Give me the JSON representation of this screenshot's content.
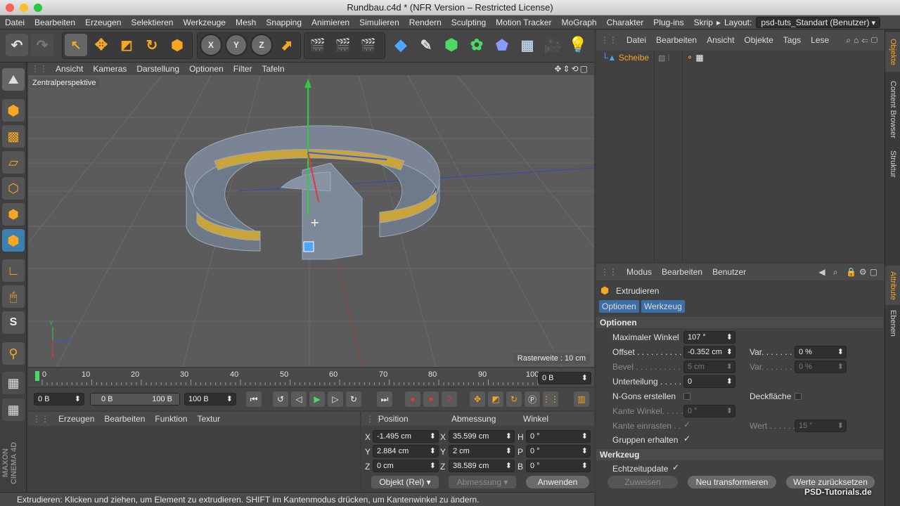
{
  "window": {
    "title": "Rundbau.c4d * (NFR Version – Restricted License)"
  },
  "menu": {
    "items": [
      "Datei",
      "Bearbeiten",
      "Erzeugen",
      "Selektieren",
      "Werkzeuge",
      "Mesh",
      "Snapping",
      "Animieren",
      "Simulieren",
      "Rendern",
      "Sculpting",
      "Motion Tracker",
      "MoGraph",
      "Charakter",
      "Plug-ins",
      "Skrip"
    ],
    "layout_label": "Layout:",
    "layout_value": "psd-tuts_Standart (Benutzer)"
  },
  "toolbar": {
    "axis_x": "X",
    "axis_y": "Y",
    "axis_z": "Z"
  },
  "viewport": {
    "menu": [
      "Ansicht",
      "Kameras",
      "Darstellung",
      "Optionen",
      "Filter",
      "Tafeln"
    ],
    "camera_label": "Zentralperspektive",
    "grid_label": "Rasterweite : 10 cm"
  },
  "timeline": {
    "ticks": [
      "0",
      "10",
      "20",
      "30",
      "40",
      "50",
      "60",
      "70",
      "80",
      "90",
      "100"
    ],
    "current": "0 B"
  },
  "transport": {
    "start": "0 B",
    "range_start": "0 B",
    "range_end": "100 B",
    "end": "100 B"
  },
  "material": {
    "menu": [
      "Erzeugen",
      "Bearbeiten",
      "Funktion",
      "Textur"
    ]
  },
  "coords": {
    "headers": {
      "position": "Position",
      "size": "Abmessung",
      "rotation": "Winkel"
    },
    "rows": [
      {
        "axis": "X",
        "pos": "-1.495 cm",
        "size_axis": "X",
        "size": "35.599 cm",
        "rot_axis": "H",
        "rot": "0 °"
      },
      {
        "axis": "Y",
        "pos": "2.884 cm",
        "size_axis": "Y",
        "size": "2 cm",
        "rot_axis": "P",
        "rot": "0 °"
      },
      {
        "axis": "Z",
        "pos": "0 cm",
        "size_axis": "Z",
        "size": "38.589 cm",
        "rot_axis": "B",
        "rot": "0 °"
      }
    ],
    "mode": "Objekt (Rel)",
    "size_mode": "Abmessung",
    "apply": "Anwenden"
  },
  "status": {
    "text": "Extrudieren: Klicken und ziehen, um Element zu extrudieren. SHIFT im Kantenmodus drücken, um Kantenwinkel zu ändern."
  },
  "objects": {
    "menu": [
      "Datei",
      "Bearbeiten",
      "Ansicht",
      "Objekte",
      "Tags",
      "Lese"
    ],
    "item": "Scheibe"
  },
  "attributes": {
    "menu": [
      "Modus",
      "Bearbeiten",
      "Benutzer"
    ],
    "title": "Extrudieren",
    "tabs": [
      "Optionen",
      "Werkzeug"
    ],
    "section_options": "Optionen",
    "max_angle_label": "Maximaler Winkel",
    "max_angle": "107 °",
    "offset_label": "Offset . . . . . . . . . . .",
    "offset": "-0.352 cm",
    "var_label": "Var. . . . . . .",
    "var": "0 %",
    "bevel_label": "Bevel . . . . . . . . . . .",
    "bevel": "5 cm",
    "var2_label": "Var. . . . . . .",
    "var2": "0 %",
    "subdiv_label": "Unterteilung . . . . .",
    "subdiv": "0",
    "ngons_label": "N-Gons erstellen",
    "cap_label": "Deckfläche",
    "edge_angle_label": "Kante Winkel. . . . .",
    "edge_angle": "0 °",
    "edge_snap_label": "Kante einrasten . .",
    "value_label": "Wert . . . . . .",
    "value": "15 °",
    "keep_groups_label": "Gruppen erhalten",
    "section_tool": "Werkzeug",
    "realtime_label": "Echtzeitupdate",
    "reset_btn": "Zuweisen",
    "new_transform_btn": "Neu transformieren",
    "reset_values_btn": "Werte zurücksetzen"
  },
  "right_tabs": [
    "Objekte",
    "Content Browser",
    "Struktur",
    "Attribute",
    "Ebenen"
  ],
  "watermark": "PSD-Tutorials.de",
  "logo": "MAXON CINEMA 4D"
}
